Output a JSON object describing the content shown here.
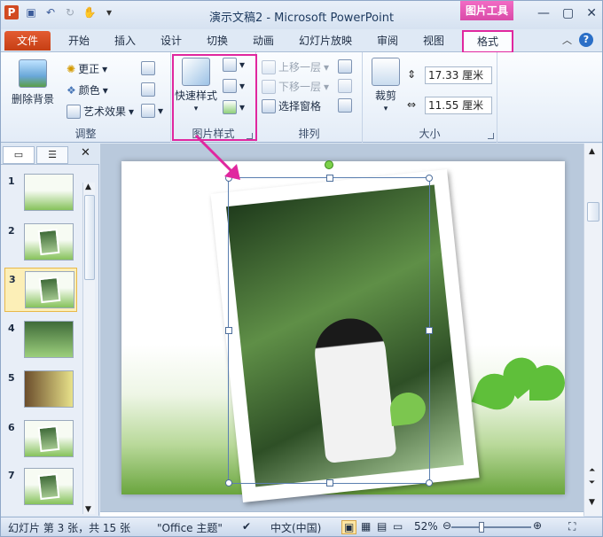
{
  "window": {
    "title": "演示文稿2 - Microsoft PowerPoint",
    "context_tool": "图片工具"
  },
  "tabs": {
    "file": "文件",
    "items": [
      "开始",
      "插入",
      "设计",
      "切换",
      "动画",
      "幻灯片放映",
      "审阅",
      "视图"
    ],
    "format": "格式"
  },
  "ribbon": {
    "adjust": {
      "remove_bg": "删除背景",
      "correct": "更正",
      "color": "颜色",
      "art_effects": "艺术效果",
      "label": "调整"
    },
    "picture_styles": {
      "quick_styles": "快速样式",
      "label": "图片样式"
    },
    "arrange": {
      "bring_forward": "上移一层",
      "send_backward": "下移一层",
      "selection_pane": "选择窗格",
      "label": "排列"
    },
    "size": {
      "crop": "裁剪",
      "height": "17.33 厘米",
      "width": "11.55 厘米",
      "label": "大小"
    }
  },
  "slides": {
    "numbers": [
      "1",
      "2",
      "3",
      "4",
      "5",
      "6",
      "7"
    ],
    "selected": 3
  },
  "status": {
    "slide_info": "幻灯片 第 3 张，共 15 张",
    "theme": "\"Office 主题\"",
    "language": "中文(中国)",
    "zoom": "52%",
    "zoom_level": 0.52
  },
  "colors": {
    "highlight": "#e0279f",
    "context_tab": "#e054b4",
    "file_tab": "#d24a21"
  }
}
